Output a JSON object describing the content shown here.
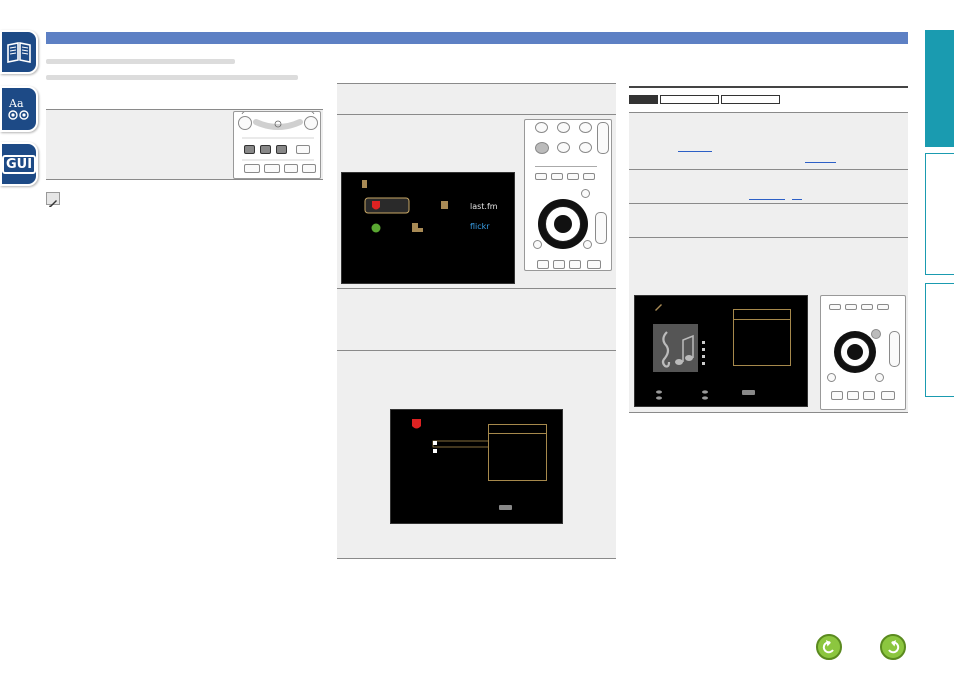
{
  "side_tabs": [
    {
      "name": "contents-tab",
      "icon": "book-icon"
    },
    {
      "name": "index-tab",
      "icon": "aa-glossary-icon"
    },
    {
      "name": "gui-tab",
      "icon": "gui-icon",
      "label": "GUI"
    }
  ],
  "screens": {
    "network_menu": {
      "lastfm_label": "last.fm",
      "flickr_label": "flickr"
    }
  },
  "nav": {
    "back_icon": "back-arrow-icon",
    "forward_icon": "forward-arrow-icon"
  },
  "colors": {
    "header_bar": "#5d80c4",
    "side_tab": "#1d4a86",
    "right_tab": "#1a9bb0",
    "nav_button": "#8cc63f",
    "menu_border": "#a6894c"
  }
}
